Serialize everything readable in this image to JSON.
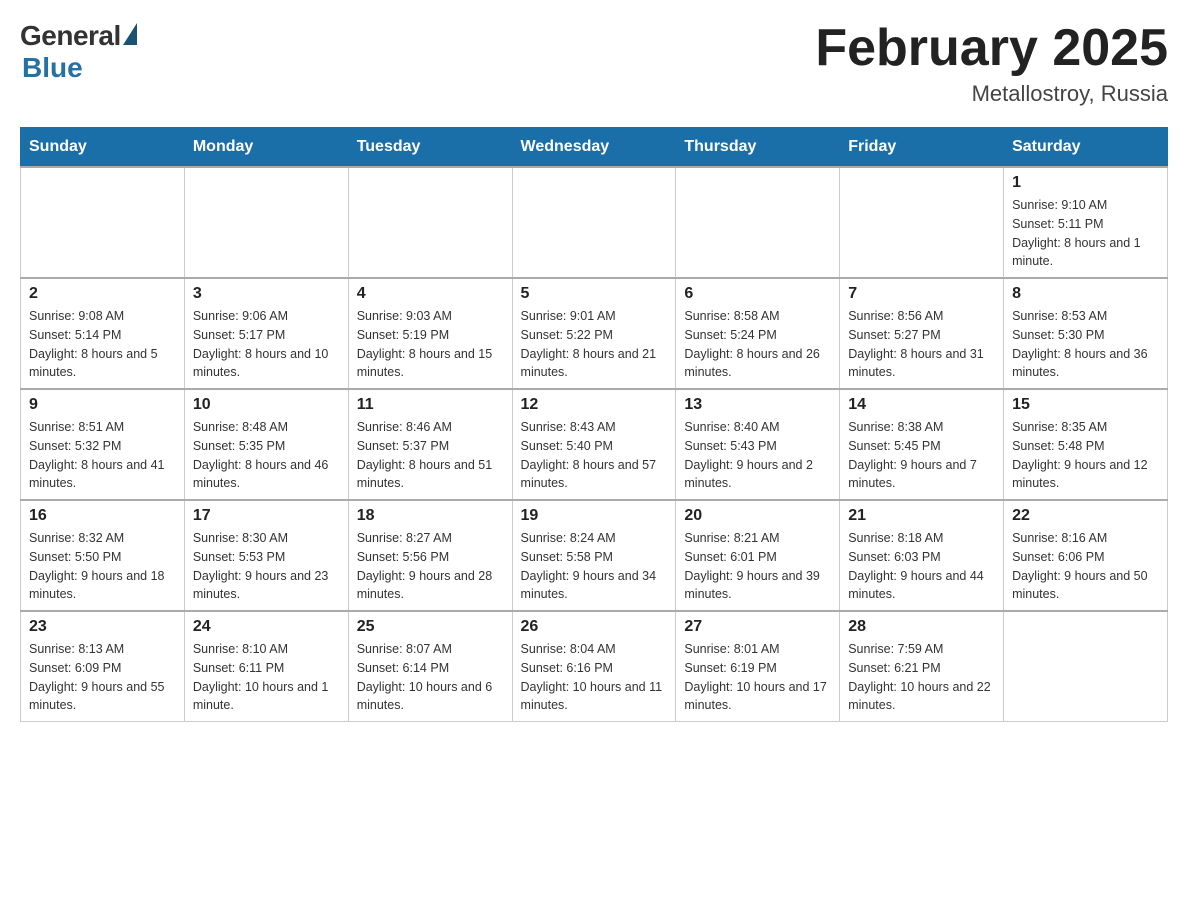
{
  "header": {
    "logo": {
      "general": "General",
      "blue": "Blue"
    },
    "title": "February 2025",
    "location": "Metallostroy, Russia"
  },
  "days_of_week": [
    "Sunday",
    "Monday",
    "Tuesday",
    "Wednesday",
    "Thursday",
    "Friday",
    "Saturday"
  ],
  "weeks": [
    [
      {
        "day": "",
        "info": ""
      },
      {
        "day": "",
        "info": ""
      },
      {
        "day": "",
        "info": ""
      },
      {
        "day": "",
        "info": ""
      },
      {
        "day": "",
        "info": ""
      },
      {
        "day": "",
        "info": ""
      },
      {
        "day": "1",
        "info": "Sunrise: 9:10 AM\nSunset: 5:11 PM\nDaylight: 8 hours and 1 minute."
      }
    ],
    [
      {
        "day": "2",
        "info": "Sunrise: 9:08 AM\nSunset: 5:14 PM\nDaylight: 8 hours and 5 minutes."
      },
      {
        "day": "3",
        "info": "Sunrise: 9:06 AM\nSunset: 5:17 PM\nDaylight: 8 hours and 10 minutes."
      },
      {
        "day": "4",
        "info": "Sunrise: 9:03 AM\nSunset: 5:19 PM\nDaylight: 8 hours and 15 minutes."
      },
      {
        "day": "5",
        "info": "Sunrise: 9:01 AM\nSunset: 5:22 PM\nDaylight: 8 hours and 21 minutes."
      },
      {
        "day": "6",
        "info": "Sunrise: 8:58 AM\nSunset: 5:24 PM\nDaylight: 8 hours and 26 minutes."
      },
      {
        "day": "7",
        "info": "Sunrise: 8:56 AM\nSunset: 5:27 PM\nDaylight: 8 hours and 31 minutes."
      },
      {
        "day": "8",
        "info": "Sunrise: 8:53 AM\nSunset: 5:30 PM\nDaylight: 8 hours and 36 minutes."
      }
    ],
    [
      {
        "day": "9",
        "info": "Sunrise: 8:51 AM\nSunset: 5:32 PM\nDaylight: 8 hours and 41 minutes."
      },
      {
        "day": "10",
        "info": "Sunrise: 8:48 AM\nSunset: 5:35 PM\nDaylight: 8 hours and 46 minutes."
      },
      {
        "day": "11",
        "info": "Sunrise: 8:46 AM\nSunset: 5:37 PM\nDaylight: 8 hours and 51 minutes."
      },
      {
        "day": "12",
        "info": "Sunrise: 8:43 AM\nSunset: 5:40 PM\nDaylight: 8 hours and 57 minutes."
      },
      {
        "day": "13",
        "info": "Sunrise: 8:40 AM\nSunset: 5:43 PM\nDaylight: 9 hours and 2 minutes."
      },
      {
        "day": "14",
        "info": "Sunrise: 8:38 AM\nSunset: 5:45 PM\nDaylight: 9 hours and 7 minutes."
      },
      {
        "day": "15",
        "info": "Sunrise: 8:35 AM\nSunset: 5:48 PM\nDaylight: 9 hours and 12 minutes."
      }
    ],
    [
      {
        "day": "16",
        "info": "Sunrise: 8:32 AM\nSunset: 5:50 PM\nDaylight: 9 hours and 18 minutes."
      },
      {
        "day": "17",
        "info": "Sunrise: 8:30 AM\nSunset: 5:53 PM\nDaylight: 9 hours and 23 minutes."
      },
      {
        "day": "18",
        "info": "Sunrise: 8:27 AM\nSunset: 5:56 PM\nDaylight: 9 hours and 28 minutes."
      },
      {
        "day": "19",
        "info": "Sunrise: 8:24 AM\nSunset: 5:58 PM\nDaylight: 9 hours and 34 minutes."
      },
      {
        "day": "20",
        "info": "Sunrise: 8:21 AM\nSunset: 6:01 PM\nDaylight: 9 hours and 39 minutes."
      },
      {
        "day": "21",
        "info": "Sunrise: 8:18 AM\nSunset: 6:03 PM\nDaylight: 9 hours and 44 minutes."
      },
      {
        "day": "22",
        "info": "Sunrise: 8:16 AM\nSunset: 6:06 PM\nDaylight: 9 hours and 50 minutes."
      }
    ],
    [
      {
        "day": "23",
        "info": "Sunrise: 8:13 AM\nSunset: 6:09 PM\nDaylight: 9 hours and 55 minutes."
      },
      {
        "day": "24",
        "info": "Sunrise: 8:10 AM\nSunset: 6:11 PM\nDaylight: 10 hours and 1 minute."
      },
      {
        "day": "25",
        "info": "Sunrise: 8:07 AM\nSunset: 6:14 PM\nDaylight: 10 hours and 6 minutes."
      },
      {
        "day": "26",
        "info": "Sunrise: 8:04 AM\nSunset: 6:16 PM\nDaylight: 10 hours and 11 minutes."
      },
      {
        "day": "27",
        "info": "Sunrise: 8:01 AM\nSunset: 6:19 PM\nDaylight: 10 hours and 17 minutes."
      },
      {
        "day": "28",
        "info": "Sunrise: 7:59 AM\nSunset: 6:21 PM\nDaylight: 10 hours and 22 minutes."
      },
      {
        "day": "",
        "info": ""
      }
    ]
  ]
}
